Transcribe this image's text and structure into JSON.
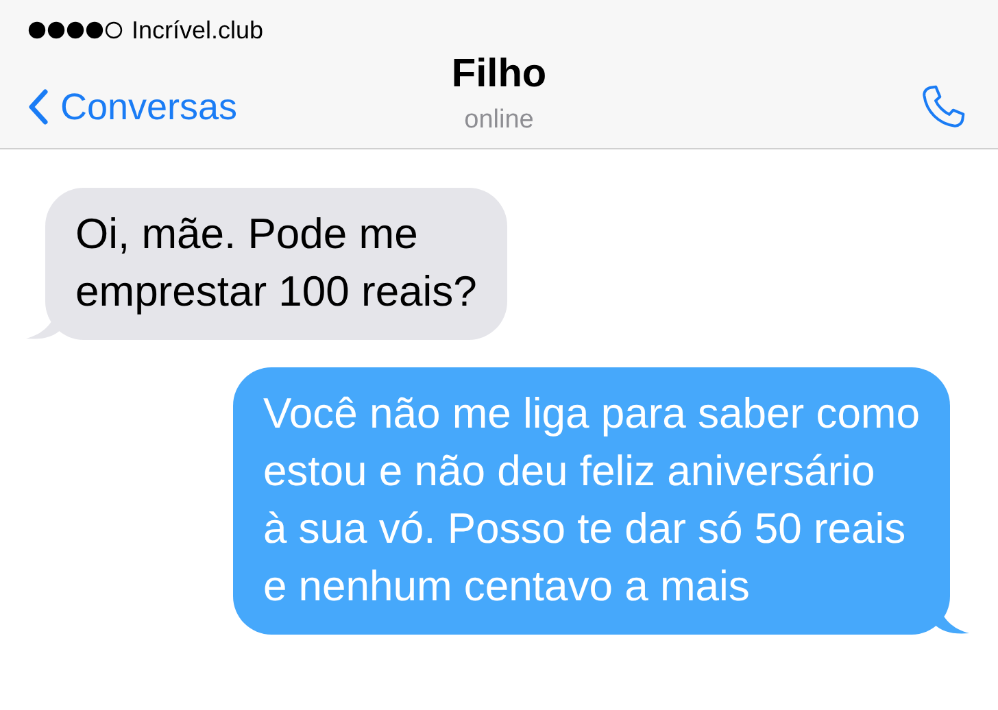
{
  "status_bar": {
    "carrier": "Incrível.club"
  },
  "nav": {
    "back_label": "Conversas",
    "title": "Filho",
    "subtitle": "online"
  },
  "messages": [
    {
      "kind": "incoming",
      "lines": [
        "Oi, mãe. Pode me",
        "emprestar 100 reais?"
      ]
    },
    {
      "kind": "outgoing",
      "lines": [
        "Você não me liga para saber como",
        "estou e não deu feliz aniversário",
        "à sua vó. Posso te dar só 50 reais",
        "e nenhum centavo a mais"
      ]
    }
  ]
}
